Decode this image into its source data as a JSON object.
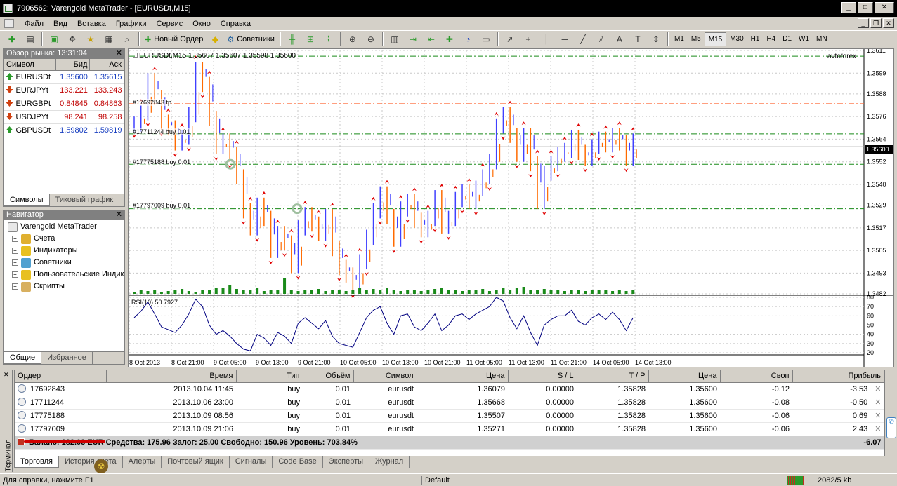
{
  "window": {
    "title": "7906562: Varengold MetaTrader - [EURUSDt,M15]"
  },
  "menu": [
    "Файл",
    "Вид",
    "Вставка",
    "Графики",
    "Сервис",
    "Окно",
    "Справка"
  ],
  "toolbar": {
    "new_order_label": "Новый Ордер",
    "experts_label": "Советники",
    "timeframes": [
      "M1",
      "M5",
      "M15",
      "M30",
      "H1",
      "H4",
      "D1",
      "W1",
      "MN"
    ],
    "selected_timeframe": "M15"
  },
  "market_watch": {
    "title": "Обзор рынка: 13:31:04",
    "columns": [
      "Символ",
      "Бид",
      "Аск"
    ],
    "rows": [
      {
        "symbol": "EURUSDt",
        "bid": "1.35600",
        "ask": "1.35615",
        "dir": "up"
      },
      {
        "symbol": "EURJPYt",
        "bid": "133.221",
        "ask": "133.243",
        "dir": "down"
      },
      {
        "symbol": "EURGBPt",
        "bid": "0.84845",
        "ask": "0.84863",
        "dir": "down"
      },
      {
        "symbol": "USDJPYt",
        "bid": "98.241",
        "ask": "98.258",
        "dir": "down"
      },
      {
        "symbol": "GBPUSDt",
        "bid": "1.59802",
        "ask": "1.59819",
        "dir": "up"
      }
    ],
    "tabs": [
      "Символы",
      "Тиковый график"
    ]
  },
  "navigator": {
    "title": "Навигатор",
    "root": "Varengold MetaTrader",
    "items": [
      "Счета",
      "Индикаторы",
      "Советники",
      "Пользовательские Индик",
      "Скрипты"
    ],
    "tabs": [
      "Общие",
      "Избранное"
    ]
  },
  "chart": {
    "header": "EURUSDt,M15  1.35607 1.35607 1.35598 1.35600",
    "watermark": "avtoforex",
    "current_price": "1.35600",
    "order_labels": [
      "#17692843 tp",
      "#17711244 buy 0.01",
      "#17775188 buy 0.01",
      "#17797009 buy 0.01"
    ],
    "rsi_label": "RSI(10) 50.7927",
    "colors": {
      "bull": "#4040ff",
      "bear": "#ff6a00",
      "arrow": "#e00000",
      "tp_line": "#ff6633",
      "order_line": "#1a8a1a",
      "rsi": "#000080"
    }
  },
  "chart_data": {
    "type": "line",
    "x_ticks": [
      "8 Oct 2013",
      "8 Oct 21:00",
      "9 Oct 05:00",
      "9 Oct 13:00",
      "9 Oct 21:00",
      "10 Oct 05:00",
      "10 Oct 13:00",
      "10 Oct 21:00",
      "11 Oct 05:00",
      "11 Oct 13:00",
      "11 Oct 21:00",
      "14 Oct 05:00",
      "14 Oct 13:00"
    ],
    "price_axis": [
      1.3611,
      1.3599,
      1.3588,
      1.3576,
      1.3564,
      1.3552,
      1.354,
      1.3529,
      1.3517,
      1.3505,
      1.3493,
      1.3482
    ],
    "ylim": [
      1.3482,
      1.3611
    ],
    "levels": {
      "tp": 1.35828,
      "order_17711244": 1.35668,
      "order_17775188": 1.35507,
      "order_17797009": 1.35271
    },
    "close_series": [
      1.3572,
      1.3578,
      1.3595,
      1.3586,
      1.3573,
      1.357,
      1.3562,
      1.3565,
      1.3577,
      1.3601,
      1.3593,
      1.3575,
      1.356,
      1.3563,
      1.3556,
      1.3544,
      1.3526,
      1.3517,
      1.3529,
      1.3522,
      1.3505,
      1.3514,
      1.3509,
      1.3497,
      1.3517,
      1.3524,
      1.3519,
      1.3514,
      1.3523,
      1.3506,
      1.3496,
      1.3492,
      1.3487,
      1.3499,
      1.3512,
      1.3526,
      1.3535,
      1.3523,
      1.3511,
      1.3527,
      1.3531,
      1.3521,
      1.3516,
      1.3522,
      1.3533,
      1.3518,
      1.3522,
      1.3532,
      1.3536,
      1.3531,
      1.3538,
      1.3544,
      1.3552,
      1.3571,
      1.3577,
      1.3566,
      1.3556,
      1.3566,
      1.3551,
      1.3531,
      1.3546,
      1.3551,
      1.3556,
      1.3558,
      1.3565,
      1.3557,
      1.3554,
      1.356,
      1.3564,
      1.3561,
      1.3566,
      1.3562,
      1.3554,
      1.3563
    ],
    "volume_series": [
      3,
      5,
      4,
      6,
      3,
      4,
      5,
      7,
      4,
      3,
      5,
      6,
      8,
      9,
      12,
      7,
      5,
      6,
      8,
      4,
      5,
      6,
      22,
      5,
      4,
      6,
      5,
      7,
      4,
      6,
      5,
      4,
      6,
      8,
      5,
      7,
      6,
      9,
      5,
      4,
      6,
      5,
      4,
      5,
      7,
      8,
      6,
      5,
      4,
      6,
      5,
      7,
      4,
      6,
      8,
      5,
      9,
      10,
      6,
      5,
      7,
      6,
      5,
      4,
      5,
      6,
      4,
      5,
      6,
      5,
      4,
      5,
      4,
      5
    ],
    "rsi": {
      "name": "RSI(10)",
      "value": 50.7927,
      "ylim": [
        20,
        80
      ],
      "levels": [
        20,
        30,
        40,
        50,
        60,
        70,
        80
      ],
      "values": [
        58,
        65,
        75,
        62,
        48,
        45,
        42,
        50,
        62,
        78,
        70,
        50,
        40,
        44,
        38,
        30,
        24,
        22,
        40,
        36,
        28,
        42,
        38,
        30,
        52,
        58,
        52,
        46,
        55,
        38,
        30,
        28,
        26,
        42,
        58,
        66,
        70,
        52,
        40,
        60,
        62,
        48,
        44,
        52,
        62,
        44,
        50,
        60,
        62,
        56,
        62,
        66,
        70,
        80,
        76,
        58,
        46,
        60,
        42,
        28,
        50,
        56,
        60,
        60,
        66,
        54,
        50,
        58,
        62,
        56,
        64,
        56,
        44,
        58
      ]
    }
  },
  "terminal": {
    "columns": [
      "Ордер",
      "Время",
      "Тип",
      "Объём",
      "Символ",
      "Цена",
      "S / L",
      "T / P",
      "Цена",
      "Своп",
      "Прибыль"
    ],
    "rows": [
      {
        "order": "17692843",
        "time": "2013.10.04 11:45",
        "type": "buy",
        "volume": "0.01",
        "symbol": "eurusdt",
        "price": "1.36079",
        "sl": "0.00000",
        "tp": "1.35828",
        "cur": "1.35600",
        "swap": "-0.12",
        "profit": "-3.53"
      },
      {
        "order": "17711244",
        "time": "2013.10.06 23:00",
        "type": "buy",
        "volume": "0.01",
        "symbol": "eurusdt",
        "price": "1.35668",
        "sl": "0.00000",
        "tp": "1.35828",
        "cur": "1.35600",
        "swap": "-0.08",
        "profit": "-0.50"
      },
      {
        "order": "17775188",
        "time": "2013.10.09 08:56",
        "type": "buy",
        "volume": "0.01",
        "symbol": "eurusdt",
        "price": "1.35507",
        "sl": "0.00000",
        "tp": "1.35828",
        "cur": "1.35600",
        "swap": "-0.06",
        "profit": "0.69"
      },
      {
        "order": "17797009",
        "time": "2013.10.09 21:06",
        "type": "buy",
        "volume": "0.01",
        "symbol": "eurusdt",
        "price": "1.35271",
        "sl": "0.00000",
        "tp": "1.35828",
        "cur": "1.35600",
        "swap": "-0.06",
        "profit": "2.43"
      }
    ],
    "summary": "Баланс: 182.03 EUR  Средства: 175.96  Залог: 25.00  Свободно: 150.96  Уровень: 703.84%",
    "total": "-6.07",
    "side_label": "Терминал",
    "tabs": [
      "Торговля",
      "История счета",
      "Алерты",
      "Почтовый ящик",
      "Сигналы",
      "Code Base",
      "Эксперты",
      "Журнал"
    ]
  },
  "status": {
    "help": "Для справки, нажмите F1",
    "profile": "Default",
    "traffic": "2082/5 kb"
  }
}
